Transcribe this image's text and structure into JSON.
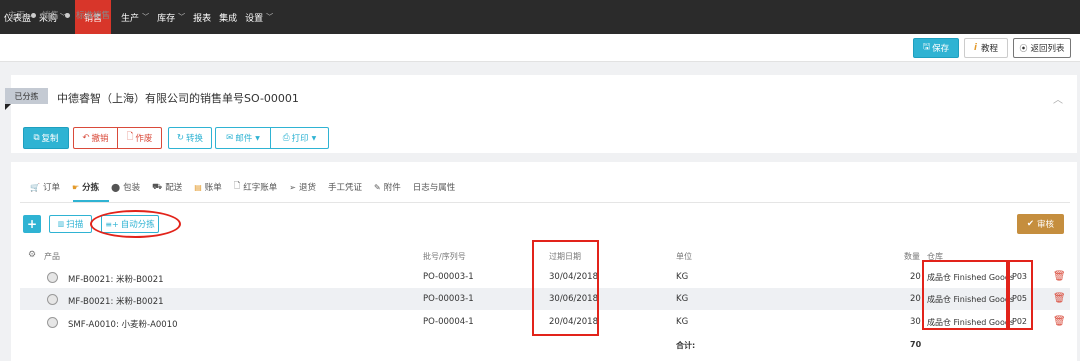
{
  "nav": {
    "items": [
      {
        "label": "仪表盘",
        "has_menu": false
      },
      {
        "label": "采购",
        "has_menu": true
      },
      {
        "label": "销售",
        "has_menu": false,
        "active": true
      },
      {
        "label": "生产",
        "has_menu": true
      },
      {
        "label": "库存",
        "has_menu": true
      },
      {
        "label": "报表",
        "has_menu": false
      },
      {
        "label": "集成",
        "has_menu": false
      },
      {
        "label": "设置",
        "has_menu": true
      }
    ]
  },
  "breadcrumb": [
    "主页",
    "销售",
    "标准销售"
  ],
  "toolbar": {
    "save": "保存",
    "tutorial": "教程",
    "back": "返回列表"
  },
  "order": {
    "status": "已分拣",
    "title": "中德睿智（上海）有限公司的销售单号SO-00001"
  },
  "actions": {
    "copy": "复制",
    "revoke": "撤销",
    "void": "作废",
    "convert": "转换",
    "email": "邮件",
    "print": "打印"
  },
  "tabs": [
    "订单",
    "分拣",
    "包装",
    "配送",
    "账单",
    "红字账单",
    "退货",
    "手工凭证",
    "附件",
    "日志与属性"
  ],
  "pick": {
    "scan": "扫描",
    "auto": "自动分拣",
    "review": "审核"
  },
  "table": {
    "headers": {
      "product": "产品",
      "lot": "批号/序列号",
      "expiry": "过期日期",
      "unit": "单位",
      "qty": "数量",
      "warehouse": "仓库"
    },
    "rows": [
      {
        "product": "MF-B0021: 米粉-B0021",
        "lot": "PO-00003-1",
        "expiry": "30/04/2018",
        "unit": "KG",
        "qty": "20",
        "warehouse": "成品仓 Finished Goods",
        "location": "P03"
      },
      {
        "product": "MF-B0021: 米粉-B0021",
        "lot": "PO-00003-1",
        "expiry": "30/06/2018",
        "unit": "KG",
        "qty": "20",
        "warehouse": "成品仓 Finished Goods",
        "location": "P05"
      },
      {
        "product": "SMF-A0010: 小麦粉-A0010",
        "lot": "PO-00004-1",
        "expiry": "20/04/2018",
        "unit": "KG",
        "qty": "30",
        "warehouse": "成品仓 Finished Goods",
        "location": "P02"
      }
    ],
    "total_label": "合计:",
    "total_qty": "70"
  },
  "colors": {
    "nav_bg": "#2b2b2b",
    "nav_active": "#d8362a",
    "accent": "#2fb3d3",
    "review": "#c58e3e",
    "danger": "#d94a3a",
    "annotation": "#e2231a"
  }
}
